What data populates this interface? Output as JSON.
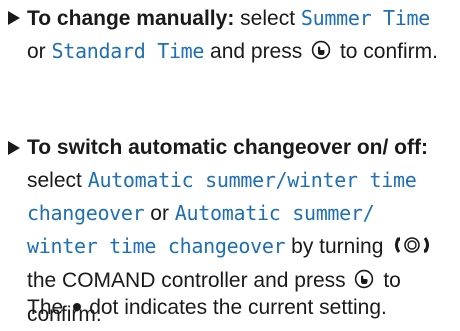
{
  "colors": {
    "text": "#1a1a1a",
    "display_text": "#1f6fb4",
    "background": "#ffffff"
  },
  "icons": [
    "arrow-bullet-icon",
    "controller-press-icon",
    "controller-turn-icon",
    "selection-dot-icon"
  ],
  "steps": [
    {
      "bold_lead": "To change manually:",
      "select": "select",
      "option1": "Summer Time",
      "or": "or",
      "option2": "Standard Time",
      "press": "and press",
      "confirm": "to confirm."
    },
    {
      "bold_lead": "To switch automatic changeover on/ off:",
      "select": "select",
      "option1": "Automatic summer/winter time changeover",
      "or": "or",
      "option2": "Automatic summer/ winter time changeover",
      "turn": "by turning",
      "controller": "the COMAND controller and press",
      "confirm": "to confirm."
    }
  ],
  "note": {
    "prefix": "The",
    "suffix": "dot indicates the current setting."
  }
}
